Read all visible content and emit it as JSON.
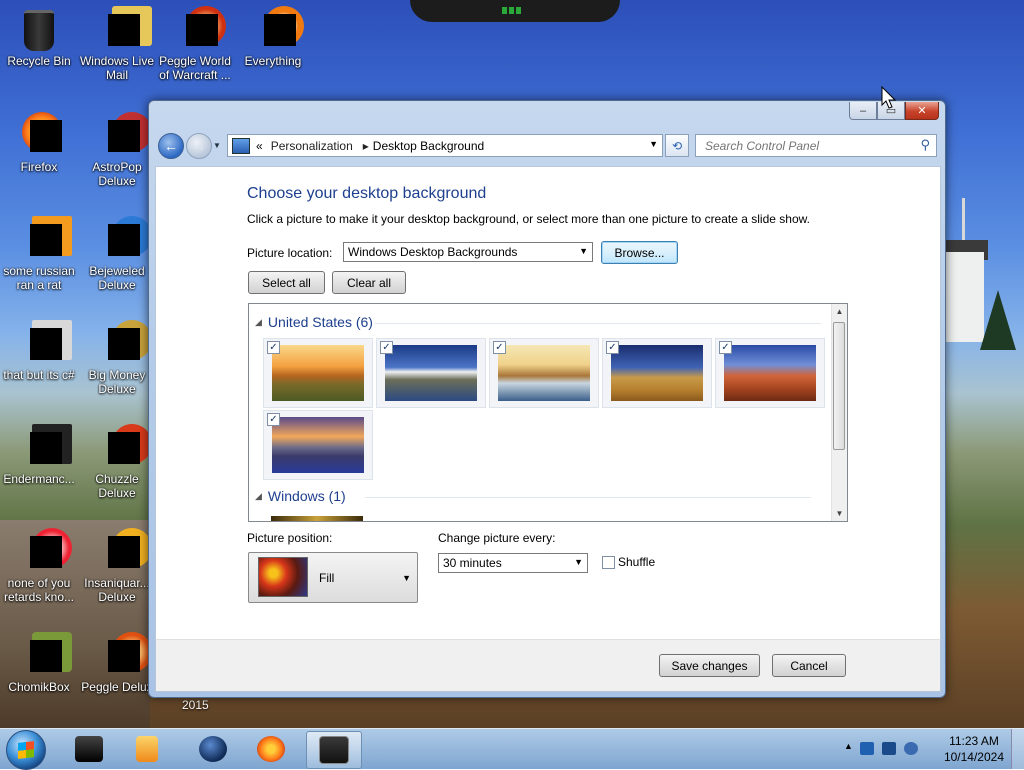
{
  "desktop_icons": [
    {
      "label": "Recycle Bin",
      "icon": "recycle-bin-icon"
    },
    {
      "label": "Windows Live Mail",
      "icon": "mail-icon"
    },
    {
      "label": "Peggle World of Warcraft ...",
      "icon": "peggle-icon"
    },
    {
      "label": "Everything",
      "icon": "search-app-icon"
    },
    {
      "label": "Firefox",
      "icon": "firefox-icon"
    },
    {
      "label": "AstroPop Deluxe",
      "icon": "game-icon"
    },
    {
      "label": "some russian ran a rat",
      "icon": "file-icon"
    },
    {
      "label": "Bejeweled Deluxe",
      "icon": "game-icon"
    },
    {
      "label": "that but its c#",
      "icon": "file-icon"
    },
    {
      "label": "Big Money Deluxe",
      "icon": "game-icon"
    },
    {
      "label": "Endermanc...",
      "icon": "app-icon"
    },
    {
      "label": "Chuzzle Deluxe",
      "icon": "game-icon"
    },
    {
      "label": "none of you retards kno...",
      "icon": "app-icon"
    },
    {
      "label": "Insaniquar... Deluxe",
      "icon": "game-icon"
    },
    {
      "label": "ChomikBox",
      "icon": "app-icon"
    },
    {
      "label": "Peggle Delux",
      "icon": "peggle-icon"
    }
  ],
  "desktop_year_label": "2015",
  "window": {
    "breadcrumb_prefix": "«",
    "breadcrumb": [
      "Personalization",
      "Desktop Background"
    ],
    "breadcrumb_sep": "▸",
    "search_placeholder": "Search Control Panel",
    "heading": "Choose your desktop background",
    "subtext": "Click a picture to make it your desktop background, or select more than one picture to create a slide show.",
    "picture_location_label": "Picture location:",
    "picture_location_value": "Windows Desktop Backgrounds",
    "browse_label": "Browse...",
    "select_all_label": "Select all",
    "clear_all_label": "Clear all",
    "groups": [
      {
        "title": "United States (6)",
        "thumbnails": [
          {
            "name": "sunset-meadow",
            "checked": true
          },
          {
            "name": "lighthouse-coast",
            "checked": true
          },
          {
            "name": "rock-arch-lake",
            "checked": true
          },
          {
            "name": "hay-bale-field",
            "checked": true
          },
          {
            "name": "delicate-arch",
            "checked": true
          },
          {
            "name": "lake-lupines",
            "checked": true
          }
        ]
      },
      {
        "title": "Windows (1)",
        "thumbnails": []
      }
    ],
    "picture_position_label": "Picture position:",
    "picture_position_value": "Fill",
    "change_picture_label": "Change picture every:",
    "change_picture_value": "30 minutes",
    "shuffle_label": "Shuffle",
    "shuffle_checked": false,
    "save_label": "Save changes",
    "cancel_label": "Cancel",
    "caption_buttons": {
      "minimize": "–",
      "maximize": "▭",
      "close": "✕"
    }
  },
  "taskbar": {
    "clock_time": "11:23 AM",
    "clock_date": "10/14/2024",
    "items": [
      "start-button",
      "app-black-box",
      "media-player",
      "globe-app",
      "firefox",
      "control-panel-window"
    ]
  }
}
